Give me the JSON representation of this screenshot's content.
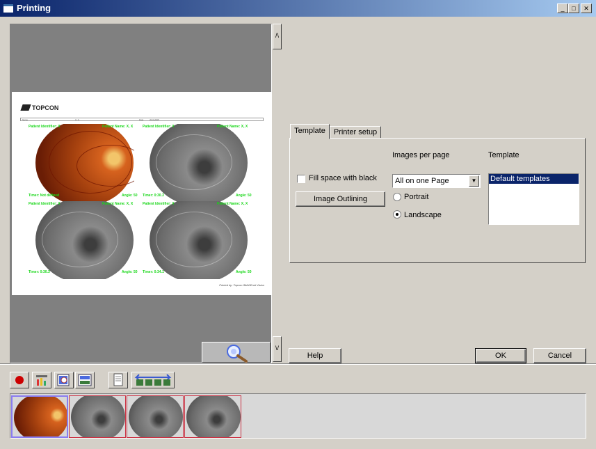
{
  "window": {
    "title": "Printing",
    "controls": {
      "minimize": "_",
      "maximize": "□",
      "close": "✕"
    }
  },
  "preview": {
    "scroll_up": "/\\",
    "scroll_down": "\\/",
    "zoom_icon": "magnifier-icon",
    "page": {
      "logo": "TOPCON",
      "header": {
        "name_label": "Name",
        "name_value": "X, X",
        "date_label": "Date",
        "date_value": "20-6-2005"
      },
      "footer": "Printed by: Topcon IMAGEnet Vision",
      "images": [
        {
          "kind": "color",
          "patient_id": "Patient Identifier: X",
          "patient_name": "Patient Name: X, X",
          "timer": "Timer: Not defined",
          "angle": "Angle: 50"
        },
        {
          "kind": "grey",
          "patient_id": "Patient Identifier: X",
          "patient_name": "Patient Name: X, X",
          "timer": "Timer: 0:30.3",
          "angle": "Angle: 50"
        },
        {
          "kind": "grey",
          "patient_id": "Patient Identifier: X",
          "patient_name": "Patient Name: X, X",
          "timer": "Timer: 0:30.3",
          "angle": "Angle: 50"
        },
        {
          "kind": "grey",
          "patient_id": "Patient Identifier: X",
          "patient_name": "Patient Name: X, X",
          "timer": "Timer: 0:34.1",
          "angle": "Angle: 50"
        }
      ]
    }
  },
  "tabs": [
    {
      "label": "Template",
      "active": true
    },
    {
      "label": "Printer setup",
      "active": false
    }
  ],
  "template_tab": {
    "fill_black_label": "Fill space with black",
    "fill_black_checked": false,
    "image_outlining_label": "Image Outlining",
    "images_per_page_label": "Images per page",
    "images_per_page_value": "All on one Page",
    "orientation_options": [
      {
        "label": "Portrait",
        "checked": false
      },
      {
        "label": "Landscape",
        "checked": true
      }
    ],
    "template_label": "Template",
    "template_items": [
      "Default templates"
    ]
  },
  "buttons": {
    "help": "Help",
    "ok": "OK",
    "cancel": "Cancel"
  },
  "toolbar": [
    {
      "name": "record-icon"
    },
    {
      "name": "chart-tool-icon"
    },
    {
      "name": "image-search-icon"
    },
    {
      "name": "image-edit-icon"
    },
    {
      "name": "page-layout-icon"
    },
    {
      "name": "image-sequence-icon"
    }
  ],
  "thumbnails": [
    {
      "kind": "color",
      "selected": true
    },
    {
      "kind": "grey",
      "selected": false
    },
    {
      "kind": "grey",
      "selected": false
    },
    {
      "kind": "grey",
      "selected": false
    }
  ],
  "colors": {
    "title_start": "#0a246a",
    "title_end": "#a6caf0",
    "overlay_text": "#17d717",
    "selection": "#0a246a"
  }
}
